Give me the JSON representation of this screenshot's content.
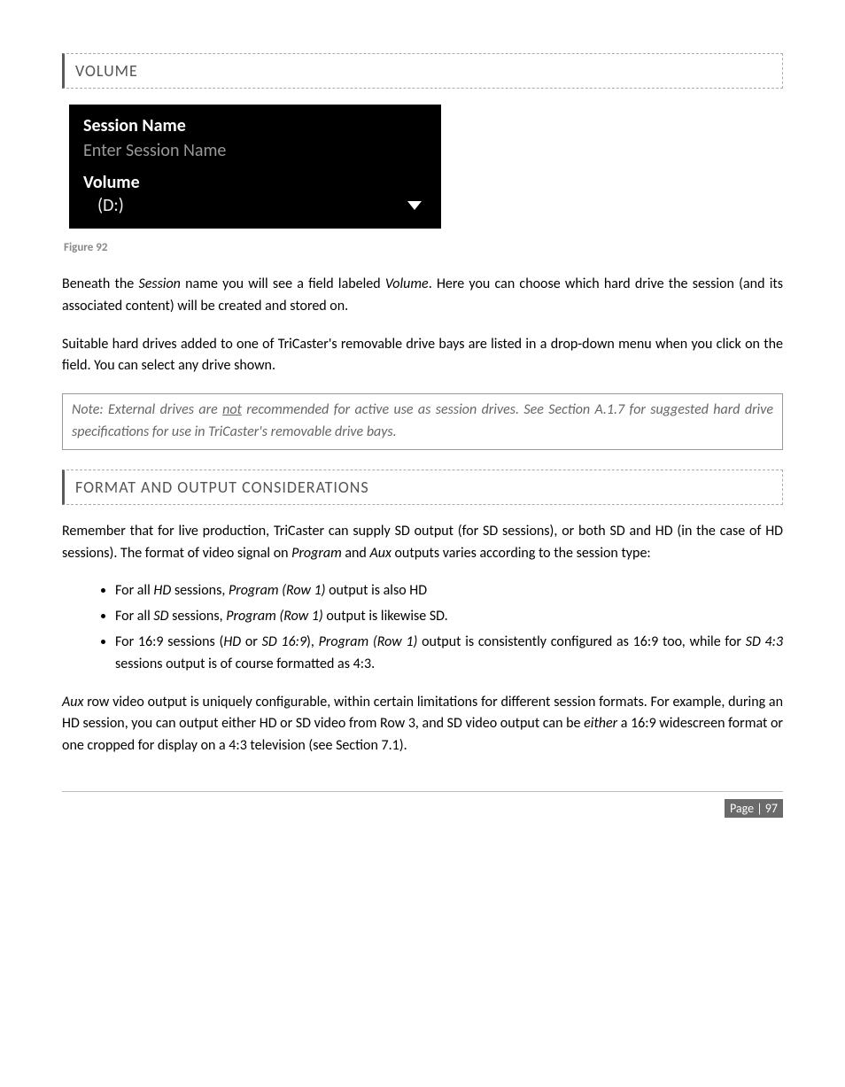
{
  "headings": {
    "volume": "VOLUME",
    "format": "FORMAT AND OUTPUT CONSIDERATIONS"
  },
  "ui": {
    "session_name_label": "Session Name",
    "session_name_placeholder": "Enter Session Name",
    "volume_label": "Volume",
    "drive": "(D:)"
  },
  "figure_label": "Figure 92",
  "body1a": "Beneath the ",
  "body1b": "Session",
  "body1c": " name you will see a field labeled ",
  "body1d": "Volume",
  "body1e": ".  Here you can choose which hard drive the session (and its associated content) will be created and stored on.",
  "body2": "Suitable hard drives added to one of TriCaster's removable drive bays are listed in a drop-down menu when you click on the field. You can select any drive shown.",
  "note1a": "Note: External drives are ",
  "note1b": "not",
  "note1c": " recommended for active use as session drives. See Section A.1.7 for suggested hard drive specifications for use in TriCaster's removable drive bays.",
  "body3a": "Remember that for live production, TriCaster can supply SD output (for SD sessions), or both SD and HD (in the case of HD sessions).  The format of video signal on ",
  "body3b": "Program",
  "body3c": " and ",
  "body3d": "Aux",
  "body3e": " outputs varies according to the session type:",
  "li1a": "For all ",
  "li1b": "HD",
  "li1c": " sessions, ",
  "li1d": "Program (Row 1)",
  "li1e": " output is also HD",
  "li2a": "For all ",
  "li2b": "SD",
  "li2c": " sessions, ",
  "li2d": "Program (Row 1)",
  "li2e": " output is likewise SD.",
  "li3a": "For 16:9 sessions (",
  "li3b": "HD",
  "li3c": " or ",
  "li3d": "SD 16:9",
  "li3e": "), ",
  "li3f": "Program (Row 1)",
  "li3g": " output is consistently configured as 16:9 too, while for ",
  "li3h": "SD 4:3",
  "li3i": " sessions output is of course formatted as 4:3.",
  "body4a": "Aux",
  "body4b": " row video output is uniquely configurable, within certain limitations for different session formats.  For example, during an HD session, you can output either HD or SD video from Row 3, and SD video output can be ",
  "body4c": "either",
  "body4d": " a 16:9 widescreen format or one cropped for display on a 4:3 television (see Section 7.1).",
  "page_number": "Page | 97"
}
